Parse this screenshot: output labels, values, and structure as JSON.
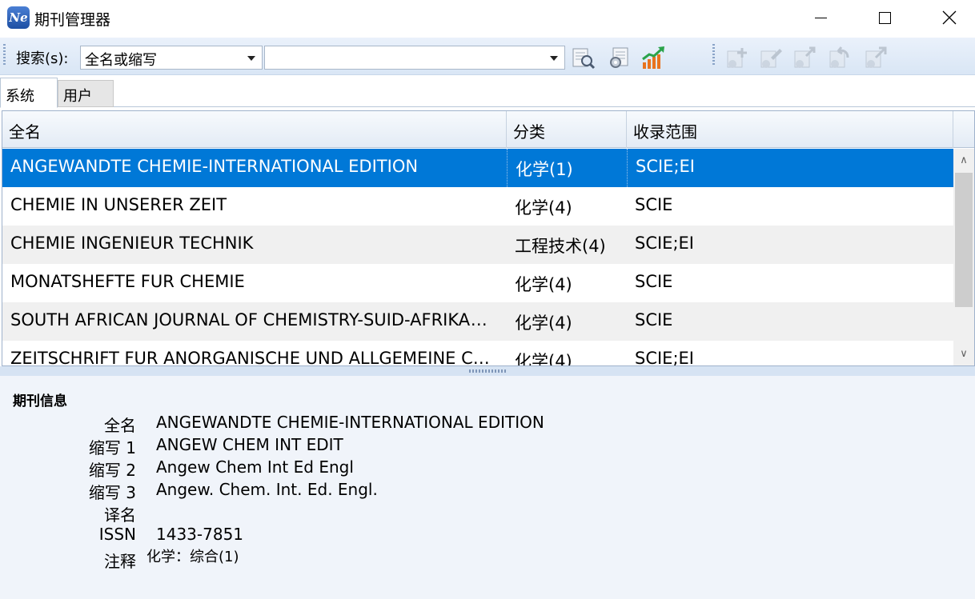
{
  "window": {
    "title": "期刊管理器",
    "icon_text": "Ne"
  },
  "toolbar": {
    "search_label": "搜索(s):",
    "field_value": "全名或缩写",
    "query_value": "",
    "icons": [
      "search-journal-icon",
      "journal-settings-icon",
      "trend-chart-icon",
      "add-journal-icon",
      "edit-journal-icon",
      "export-journal-icon",
      "undo-journal-icon",
      "redo-journal-icon"
    ]
  },
  "tabs": [
    {
      "label": "系统",
      "active": true
    },
    {
      "label": "用户",
      "active": false
    }
  ],
  "grid": {
    "columns": [
      "全名",
      "分类",
      "收录范围"
    ],
    "rows": [
      {
        "name": "ANGEWANDTE CHEMIE-INTERNATIONAL EDITION",
        "category": "化学(1)",
        "range": "SCIE;EI",
        "selected": true
      },
      {
        "name": "CHEMIE IN UNSERER ZEIT",
        "category": "化学(4)",
        "range": "SCIE",
        "selected": false
      },
      {
        "name": "CHEMIE INGENIEUR TECHNIK",
        "category": "工程技术(4)",
        "range": "SCIE;EI",
        "selected": false
      },
      {
        "name": "MONATSHEFTE FUR CHEMIE",
        "category": "化学(4)",
        "range": "SCIE",
        "selected": false
      },
      {
        "name": "SOUTH AFRICAN JOURNAL OF CHEMISTRY-SUID-AFRIKAANSE TYDSKRIF VIR CHEMIE",
        "category": "化学(4)",
        "range": "SCIE",
        "selected": false
      },
      {
        "name": "ZEITSCHRIFT FUR ANORGANISCHE UND ALLGEMEINE CHEMIE",
        "category": "化学(4)",
        "range": "SCIE;EI",
        "selected": false
      }
    ]
  },
  "info": {
    "title": "期刊信息",
    "fields": [
      {
        "label": "全名",
        "value": "ANGEWANDTE CHEMIE-INTERNATIONAL EDITION"
      },
      {
        "label": "缩写 1",
        "value": "ANGEW CHEM INT EDIT"
      },
      {
        "label": "缩写 2",
        "value": "Angew Chem Int Ed Engl"
      },
      {
        "label": "缩写 3",
        "value": "Angew. Chem. Int. Ed. Engl."
      },
      {
        "label": "译名",
        "value": ""
      },
      {
        "label": "ISSN",
        "value": "1433-7851"
      },
      {
        "label": "注释",
        "value": "化学：综合(1)"
      }
    ]
  },
  "colors": {
    "selection": "#0078d7",
    "toolbar_bg": "#dfe9f6",
    "panel_bg": "#f0f4fa"
  }
}
